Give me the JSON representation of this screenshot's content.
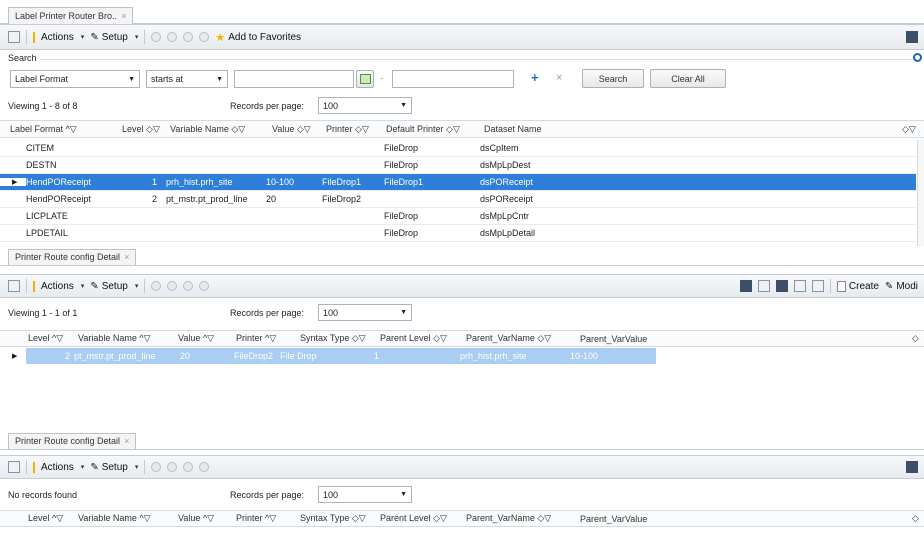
{
  "top_tab": {
    "label": "Label Printer Router Bro..",
    "close": "×"
  },
  "toolbar1": {
    "actions": "Actions",
    "setup": "Setup",
    "favorites": "Add to Favorites"
  },
  "search": {
    "label": "Search",
    "field_value": "Label Format",
    "operator_value": "starts at",
    "value": "",
    "value2": "",
    "search_button": "Search",
    "clear_button": "Clear All"
  },
  "grid1": {
    "viewing": "Viewing 1 - 8 of 8",
    "records_label": "Records per page:",
    "records_value": "100",
    "columns": [
      "Label Format",
      "Level",
      "Variable Name",
      "Value",
      "Printer",
      "Default Printer",
      "Dataset Name"
    ],
    "rows": [
      {
        "format": "CITEM",
        "level": "",
        "var": "",
        "value": "",
        "printer": "",
        "default": "FileDrop",
        "dataset": "dsCpItem"
      },
      {
        "format": "DESTN",
        "level": "",
        "var": "",
        "value": "",
        "printer": "",
        "default": "FileDrop",
        "dataset": "dsMpLpDest"
      },
      {
        "format": "HendPOReceipt",
        "level": "1",
        "var": "prh_hist.prh_site",
        "value": "10-100",
        "printer": "FileDrop1",
        "default": "FileDrop1",
        "dataset": "dsPOReceipt"
      },
      {
        "format": "HendPOReceipt",
        "level": "2",
        "var": "pt_mstr.pt_prod_line",
        "value": "20",
        "printer": "FileDrop2",
        "default": "",
        "dataset": "dsPOReceipt"
      },
      {
        "format": "LICPLATE",
        "level": "",
        "var": "",
        "value": "",
        "printer": "",
        "default": "FileDrop",
        "dataset": "dsMpLpCntr"
      },
      {
        "format": "LPDETAIL",
        "level": "",
        "var": "",
        "value": "",
        "printer": "",
        "default": "FileDrop",
        "dataset": "dsMpLpDetail"
      }
    ]
  },
  "detail1": {
    "tab": "Printer Route config Detail",
    "close": "×",
    "actions": "Actions",
    "setup": "Setup",
    "create": "Create",
    "modify": "Modi",
    "viewing": "Viewing 1 - 1 of 1",
    "records_label": "Records per page:",
    "records_value": "100",
    "columns": [
      "Level",
      "Variable Name",
      "Value",
      "Printer",
      "Syntax Type",
      "Parent Level",
      "Parent_VarName",
      "Parent_VarValue"
    ],
    "rows": [
      {
        "level": "2",
        "var": "pt_mstr.pt_prod_line",
        "value": "20",
        "printer": "FileDrop2",
        "syntax": "File Drop",
        "plevel": "1",
        "pvar": "prh_hist.prh_site",
        "pval": "10-100"
      }
    ]
  },
  "detail2": {
    "tab": "Printer Route config Detail",
    "close": "×",
    "actions": "Actions",
    "setup": "Setup",
    "viewing": "No records found",
    "records_label": "Records per page:",
    "records_value": "100",
    "columns": [
      "Level",
      "Variable Name",
      "Value",
      "Printer",
      "Syntax Type",
      "Parent Level",
      "Parent_VarName",
      "Parent_VarValue"
    ]
  }
}
